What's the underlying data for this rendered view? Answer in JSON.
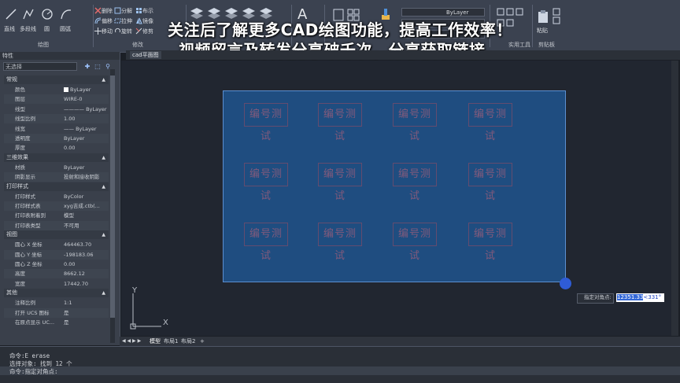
{
  "ribbon": {
    "draw": {
      "line": "直线",
      "polyline": "多段线",
      "circle": "圆",
      "arc": "圆弧",
      "footer": "绘图"
    },
    "modify": {
      "erase": "删除",
      "explode": "分解",
      "array": "布示",
      "offset": "偏移",
      "stretch": "拉伸",
      "mirror": "镜像",
      "move": "移动",
      "rotate": "旋转",
      "trim": "修剪",
      "footer": "修改"
    },
    "annotation": {
      "text": "A"
    },
    "layer_value": "ByLayer",
    "utilities_footer": "实用工具",
    "paste": "粘贴",
    "clipboard_footer": "剪贴板"
  },
  "overlay": {
    "line1": "关注后了解更多CAD绘图功能，提高工作效率！",
    "line2": "视频留言及转发分享破千次，分享获取链接。"
  },
  "document_tab": "cad平面图",
  "palette": {
    "title": "特性",
    "selection": "无选择",
    "sections": [
      {
        "name": "常规",
        "rows": [
          {
            "key": "颜色",
            "value": "ByLayer",
            "swatch": "#ffffff"
          },
          {
            "key": "图层",
            "value": "WIRE-0"
          },
          {
            "key": "线型",
            "value": "———— ByLayer"
          },
          {
            "key": "线型比例",
            "value": "1.00"
          },
          {
            "key": "线宽",
            "value": "—— ByLayer"
          },
          {
            "key": "透明度",
            "value": "ByLayer"
          },
          {
            "key": "厚度",
            "value": "0.00"
          }
        ]
      },
      {
        "name": "三维效果",
        "rows": [
          {
            "key": "材质",
            "value": "ByLayer"
          },
          {
            "key": "阴影显示",
            "value": "投射和接收阴影"
          }
        ]
      },
      {
        "name": "打印样式",
        "rows": [
          {
            "key": "打印样式",
            "value": "ByColor"
          },
          {
            "key": "打印样式表",
            "value": "xyg吉成.ctb(..."
          },
          {
            "key": "打印表附着到",
            "value": "模型"
          },
          {
            "key": "打印表类型",
            "value": "不可用"
          }
        ]
      },
      {
        "name": "视图",
        "rows": [
          {
            "key": "圆心 X 坐标",
            "value": "464463.70"
          },
          {
            "key": "圆心 Y 坐标",
            "value": "-198183.06"
          },
          {
            "key": "圆心 Z 坐标",
            "value": "0.00"
          },
          {
            "key": "高度",
            "value": "8662.12"
          },
          {
            "key": "宽度",
            "value": "17442.70"
          }
        ]
      },
      {
        "name": "其他",
        "rows": [
          {
            "key": "注释比例",
            "value": "1:1"
          },
          {
            "key": "打开 UCS 图标",
            "value": "是"
          },
          {
            "key": "在原点显示 UC...",
            "value": "是"
          }
        ]
      }
    ]
  },
  "canvas": {
    "stamp_text": "编号测试",
    "ucs_y": "Y",
    "ucs_x": "X"
  },
  "tooltip": {
    "prompt": "指定对角点:",
    "value_selected": "12351.33",
    "value_rest": "<331°"
  },
  "layout_tabs": {
    "nav": "◀ ◀ ▶ ▶",
    "model": "模型",
    "layout1": "布局1",
    "layout2": "布局2",
    "add": "+"
  },
  "command": {
    "lines": [
      "命令:E erase",
      "选择对象: 找到 12 个",
      "命令:指定对角点:"
    ]
  },
  "colors": {
    "selection_fill": "#1f4d80",
    "selection_border": "#5c8fd0",
    "cursor": "#2f5cd6",
    "stamp": "#a35f7a"
  }
}
